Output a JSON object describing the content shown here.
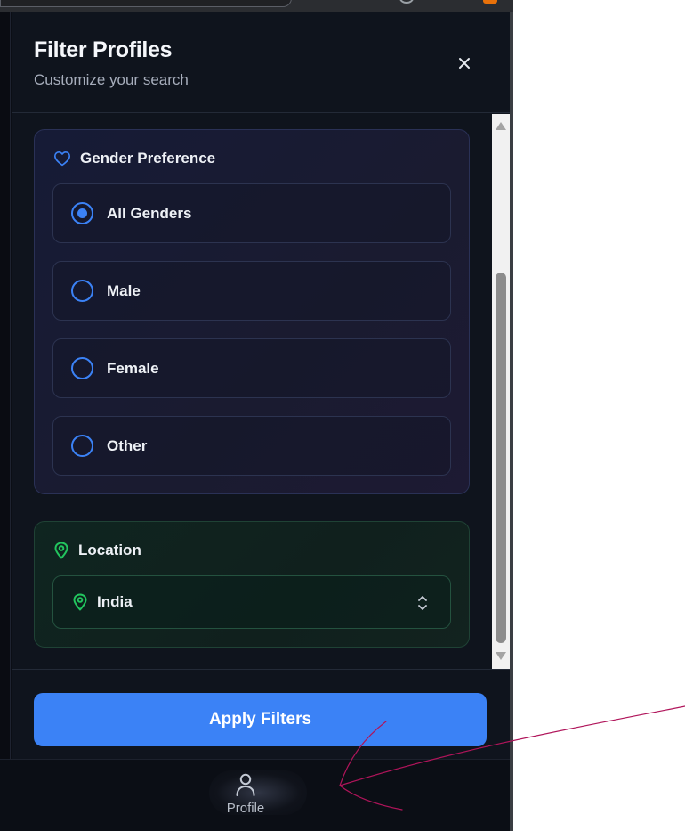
{
  "panel": {
    "title": "Filter Profiles",
    "subtitle": "Customize your search",
    "close_icon": "close-icon"
  },
  "gender": {
    "title": "Gender Preference",
    "icon": "heart-icon",
    "selected": "All Genders",
    "options": [
      {
        "label": "All Genders",
        "selected": true
      },
      {
        "label": "Male",
        "selected": false
      },
      {
        "label": "Female",
        "selected": false
      },
      {
        "label": "Other",
        "selected": false
      }
    ]
  },
  "location": {
    "title": "Location",
    "icon": "map-pin-icon",
    "value": "India",
    "select_icon": "chevron-up-down-icon"
  },
  "footer": {
    "apply_label": "Apply Filters"
  },
  "bottom_nav": {
    "items": [
      {
        "label": "Profile",
        "icon": "user-icon"
      }
    ]
  },
  "colors": {
    "accent": "#3b82f6",
    "location_accent": "#22c55e",
    "background": "#0f141d",
    "annotation_stroke": "#b0145a"
  }
}
